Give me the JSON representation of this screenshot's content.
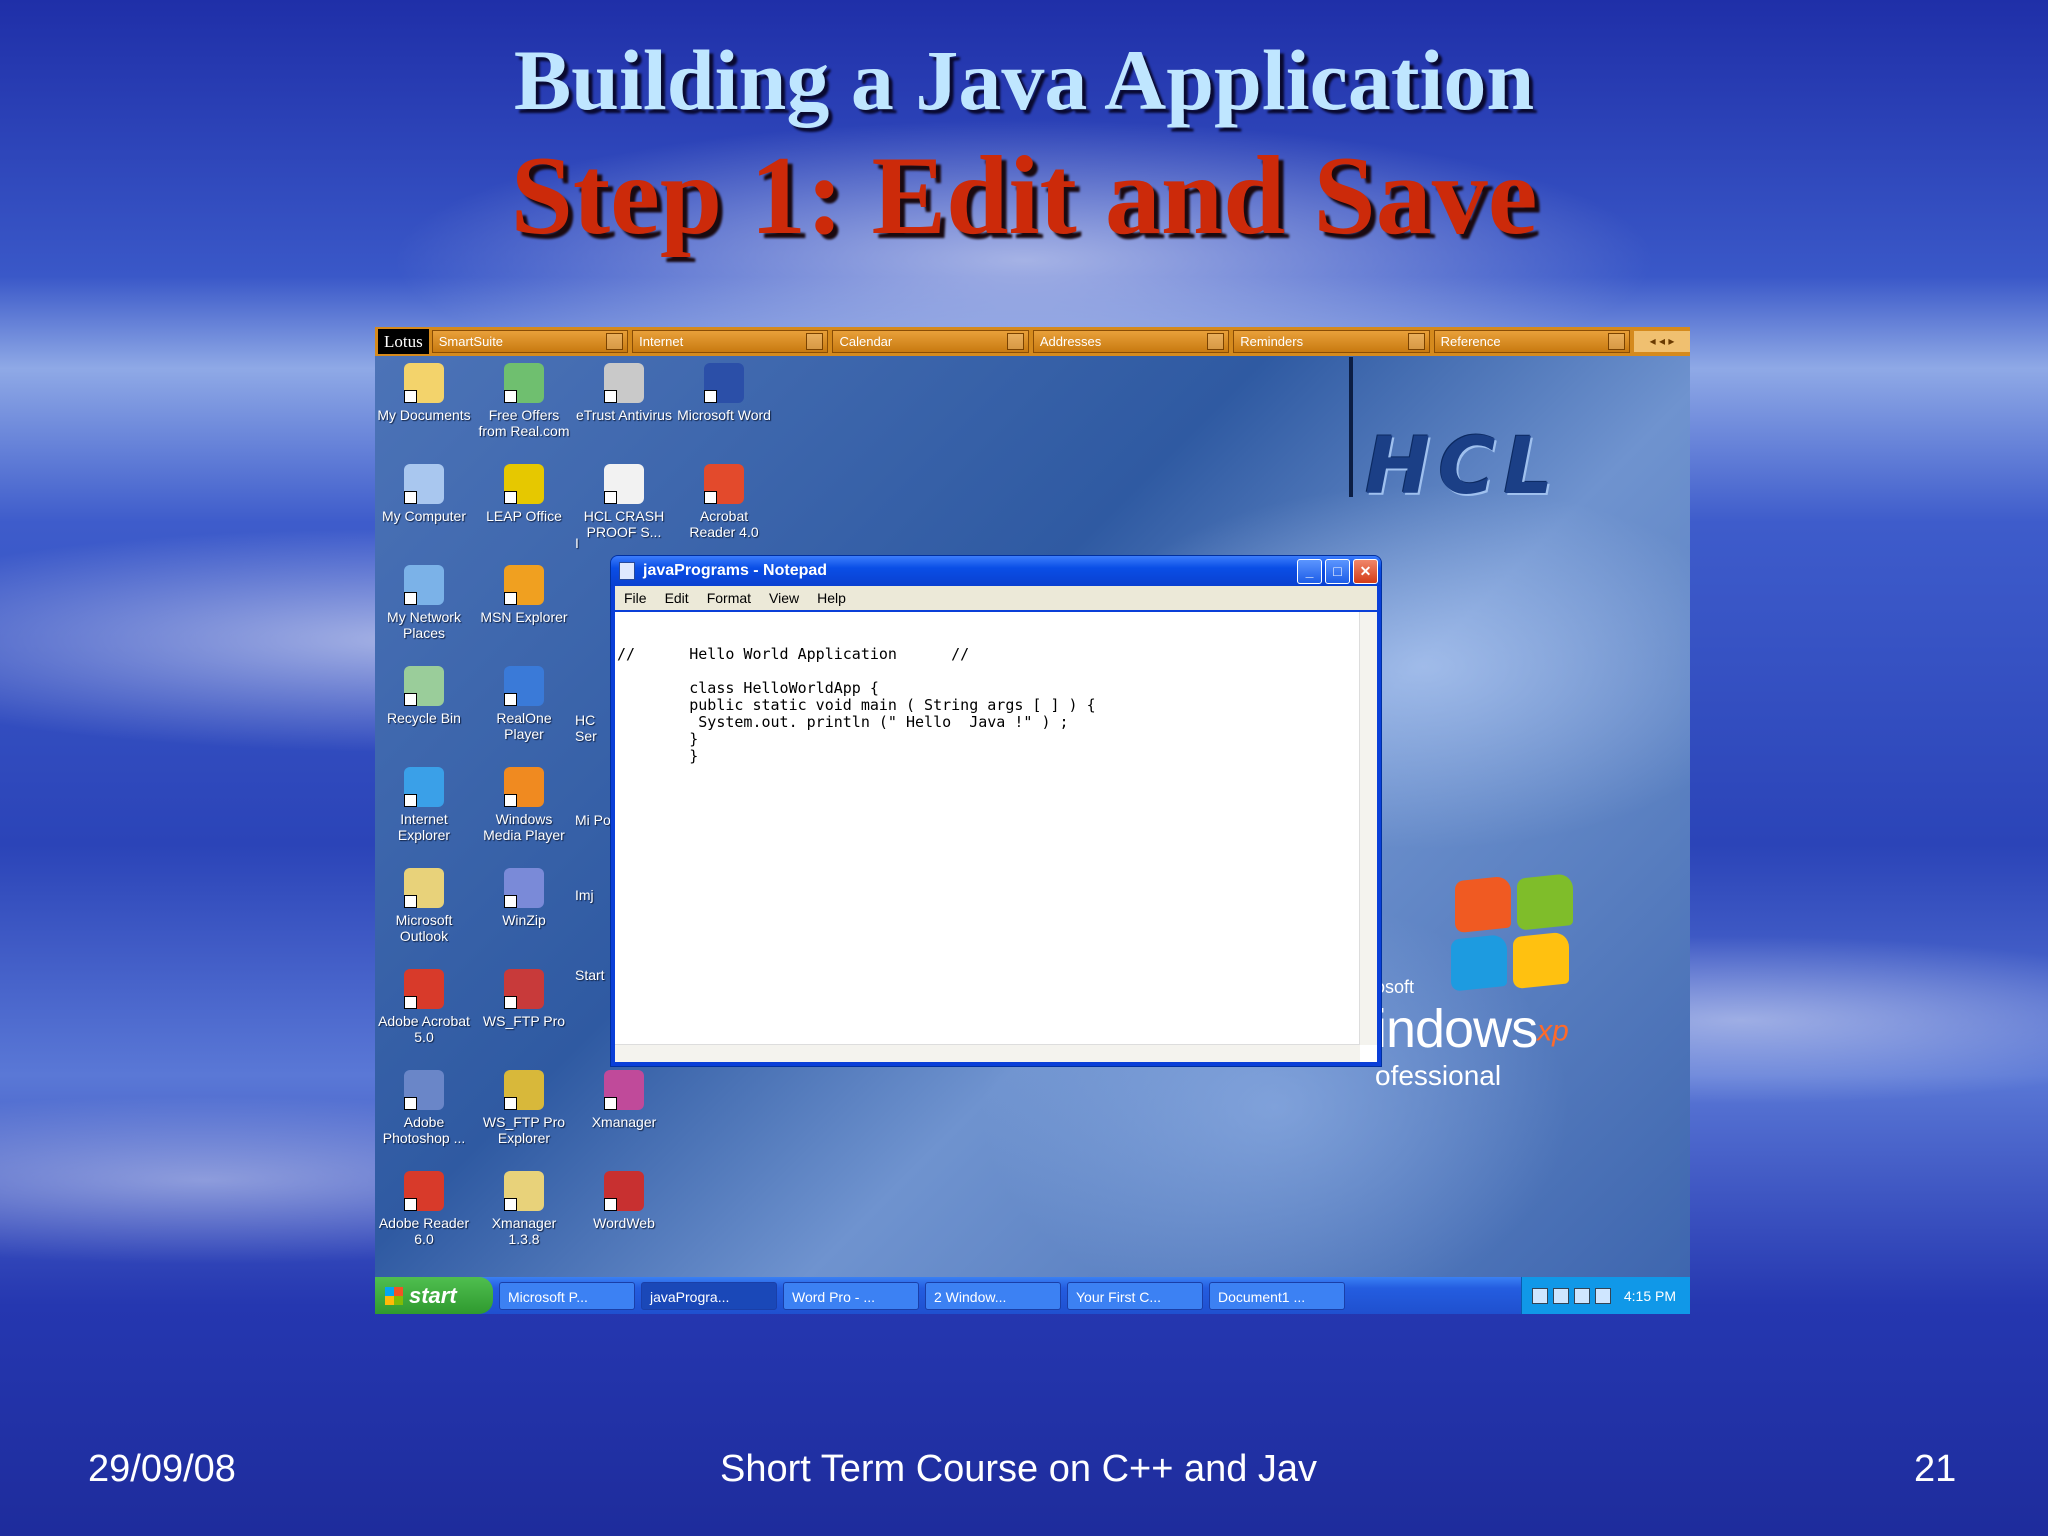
{
  "slide": {
    "title_line1": "Building a Java Application",
    "title_line2": "Step 1: Edit and Save",
    "footer_date": "29/09/08",
    "footer_course": "Short Term Course on C++ and Jav",
    "footer_page": "21"
  },
  "lotus_bar": {
    "logo": "Lotus",
    "segments": [
      "SmartSuite",
      "Internet",
      "Calendar",
      "Addresses",
      "Reminders",
      "Reference"
    ]
  },
  "desktop": {
    "wallpaper_text": "HCL",
    "os_brand": {
      "microsoft": "osoft",
      "windows": "indows",
      "xp": "xp",
      "edition": "ofessional"
    },
    "icons": [
      {
        "label": "My Documents",
        "icon": "folder-icon",
        "color": "#f3d36b"
      },
      {
        "label": "Free Offers from Real.com",
        "icon": "gift-icon",
        "color": "#6fbf6f"
      },
      {
        "label": "eTrust Antivirus",
        "icon": "shield-icon",
        "color": "#c9c9c9"
      },
      {
        "label": "Microsoft Word",
        "icon": "word-icon",
        "color": "#2b4fa8"
      },
      {
        "label": "My Computer",
        "icon": "computer-icon",
        "color": "#a9c7ef"
      },
      {
        "label": "LEAP Office",
        "icon": "leap-icon",
        "color": "#e6c800"
      },
      {
        "label": "HCL CRASH PROOF S...",
        "icon": "document-icon",
        "color": "#f2f2f2"
      },
      {
        "label": "Acrobat Reader 4.0",
        "icon": "acrobat-icon",
        "color": "#e34a2c"
      },
      {
        "label": "My Network Places",
        "icon": "network-icon",
        "color": "#7bb2e8"
      },
      {
        "label": "MSN Explorer",
        "icon": "msn-icon",
        "color": "#f0a020"
      },
      {
        "label": "Recycle Bin",
        "icon": "recycle-bin-icon",
        "color": "#9acd9a"
      },
      {
        "label": "RealOne Player",
        "icon": "realone-icon",
        "color": "#3a7ad8"
      },
      {
        "label": "Internet Explorer",
        "icon": "internet-explorer-icon",
        "color": "#3aa0e8"
      },
      {
        "label": "Windows Media Player",
        "icon": "media-player-icon",
        "color": "#f08a20"
      },
      {
        "label": "Microsoft Outlook",
        "icon": "outlook-icon",
        "color": "#e8d27a"
      },
      {
        "label": "WinZip",
        "icon": "winzip-icon",
        "color": "#7a8ad8"
      },
      {
        "label": "Adobe Acrobat 5.0",
        "icon": "acrobat-icon",
        "color": "#d83a2a"
      },
      {
        "label": "WS_FTP Pro",
        "icon": "ftp-icon",
        "color": "#c83a3a"
      },
      {
        "label": "Adobe Photoshop ...",
        "icon": "photoshop-icon",
        "color": "#6a86c8"
      },
      {
        "label": "WS_FTP Pro Explorer",
        "icon": "ftp-icon",
        "color": "#d8b83a"
      },
      {
        "label": "Xmanager",
        "icon": "xmanager-icon",
        "color": "#c04a9a"
      },
      {
        "label": "Adobe Reader 6.0",
        "icon": "adobe-reader-icon",
        "color": "#d83a2a"
      },
      {
        "label": "Xmanager 1.3.8",
        "icon": "folder-icon",
        "color": "#e8d27a"
      },
      {
        "label": "WordWeb",
        "icon": "wordweb-icon",
        "color": "#c83030"
      }
    ],
    "partial_icons": [
      "I",
      "HC Ser",
      "Mi Po",
      "Imj",
      "Start"
    ]
  },
  "notepad": {
    "title": "javaPrograms - Notepad",
    "menu": [
      "File",
      "Edit",
      "Format",
      "View",
      "Help"
    ],
    "content": "//      Hello World Application      //\n\n        class HelloWorldApp {\n        public static void main ( String args [ ] ) {\n         System.out. println (\" Hello  Java !\" ) ;\n        }\n        }",
    "buttons": {
      "minimize": "_",
      "maximize": "□",
      "close": "✕"
    }
  },
  "taskbar": {
    "start": "start",
    "tasks": [
      "Microsoft P...",
      "javaProgra...",
      "Word Pro - ...",
      "2 Window...",
      "Your First C...",
      "Document1 ..."
    ],
    "clock": "4:15 PM"
  },
  "colors": {
    "title1": "#bfe6ff",
    "title2": "#cc2a0a",
    "xp_blue": "#0a4ee6",
    "lotus_orange": "#d58a1d"
  }
}
